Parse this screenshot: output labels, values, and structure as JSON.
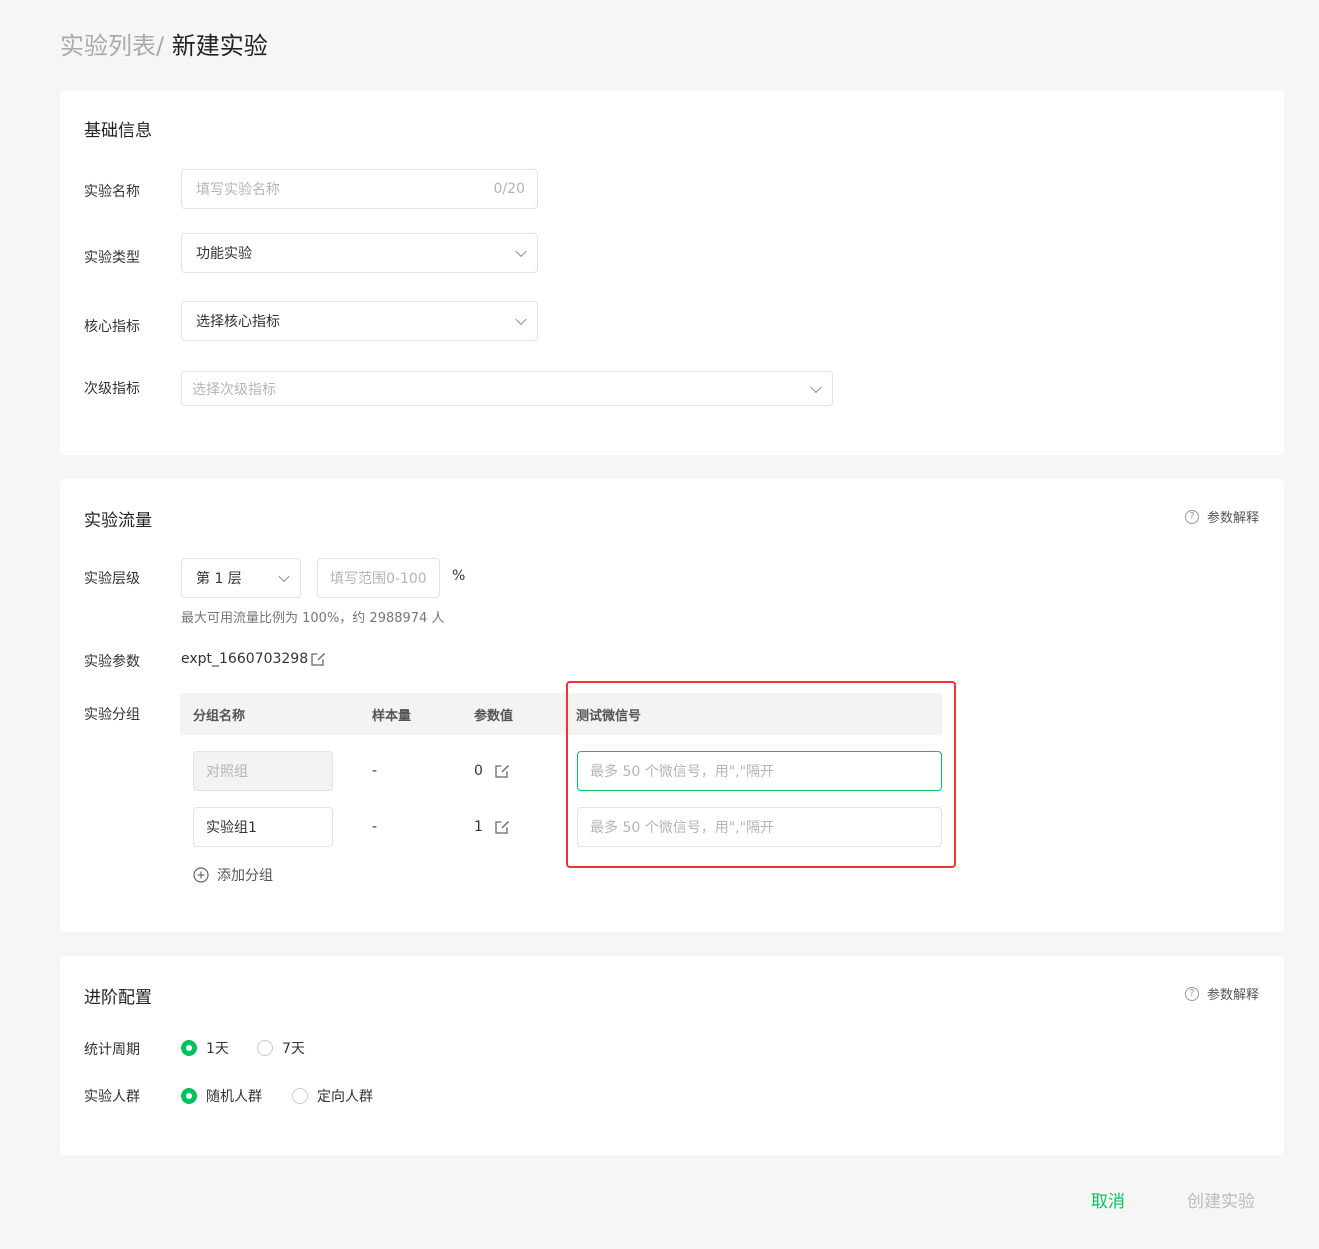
{
  "breadcrumb": {
    "parent": "实验列表/",
    "current": "新建实验"
  },
  "basic": {
    "title": "基础信息",
    "name_label": "实验名称",
    "name_placeholder": "填写实验名称",
    "name_count": "0/20",
    "type_label": "实验类型",
    "type_value": "功能实验",
    "core_label": "核心指标",
    "core_value": "选择核心指标",
    "secondary_label": "次级指标",
    "secondary_placeholder": "选择次级指标"
  },
  "traffic": {
    "title": "实验流量",
    "help": "参数解释",
    "layer_label": "实验层级",
    "layer_value": "第 1 层",
    "range_placeholder": "填写范围0-100",
    "percent": "%",
    "hint": "最大可用流量比例为 100%，约 2988974 人",
    "param_label": "实验参数",
    "param_value": "expt_1660703298",
    "group_label": "实验分组",
    "columns": [
      "分组名称",
      "样本量",
      "参数值",
      "测试微信号"
    ],
    "rows": [
      {
        "name": "对照组",
        "sample": "-",
        "value": "0",
        "wechat_placeholder": "最多 50 个微信号，用\",\"隔开"
      },
      {
        "name": "实验组1",
        "sample": "-",
        "value": "1",
        "wechat_placeholder": "最多 50 个微信号，用\",\"隔开"
      }
    ],
    "add_group": "添加分组"
  },
  "advanced": {
    "title": "进阶配置",
    "help": "参数解释",
    "period_label": "统计周期",
    "period_options": [
      "1天",
      "7天"
    ],
    "period_selected": "1天",
    "audience_label": "实验人群",
    "audience_options": [
      "随机人群",
      "定向人群"
    ],
    "audience_selected": "随机人群"
  },
  "footer": {
    "cancel": "取消",
    "create": "创建实验"
  },
  "colors": {
    "accent": "#07c160",
    "highlight": "#e33333"
  }
}
